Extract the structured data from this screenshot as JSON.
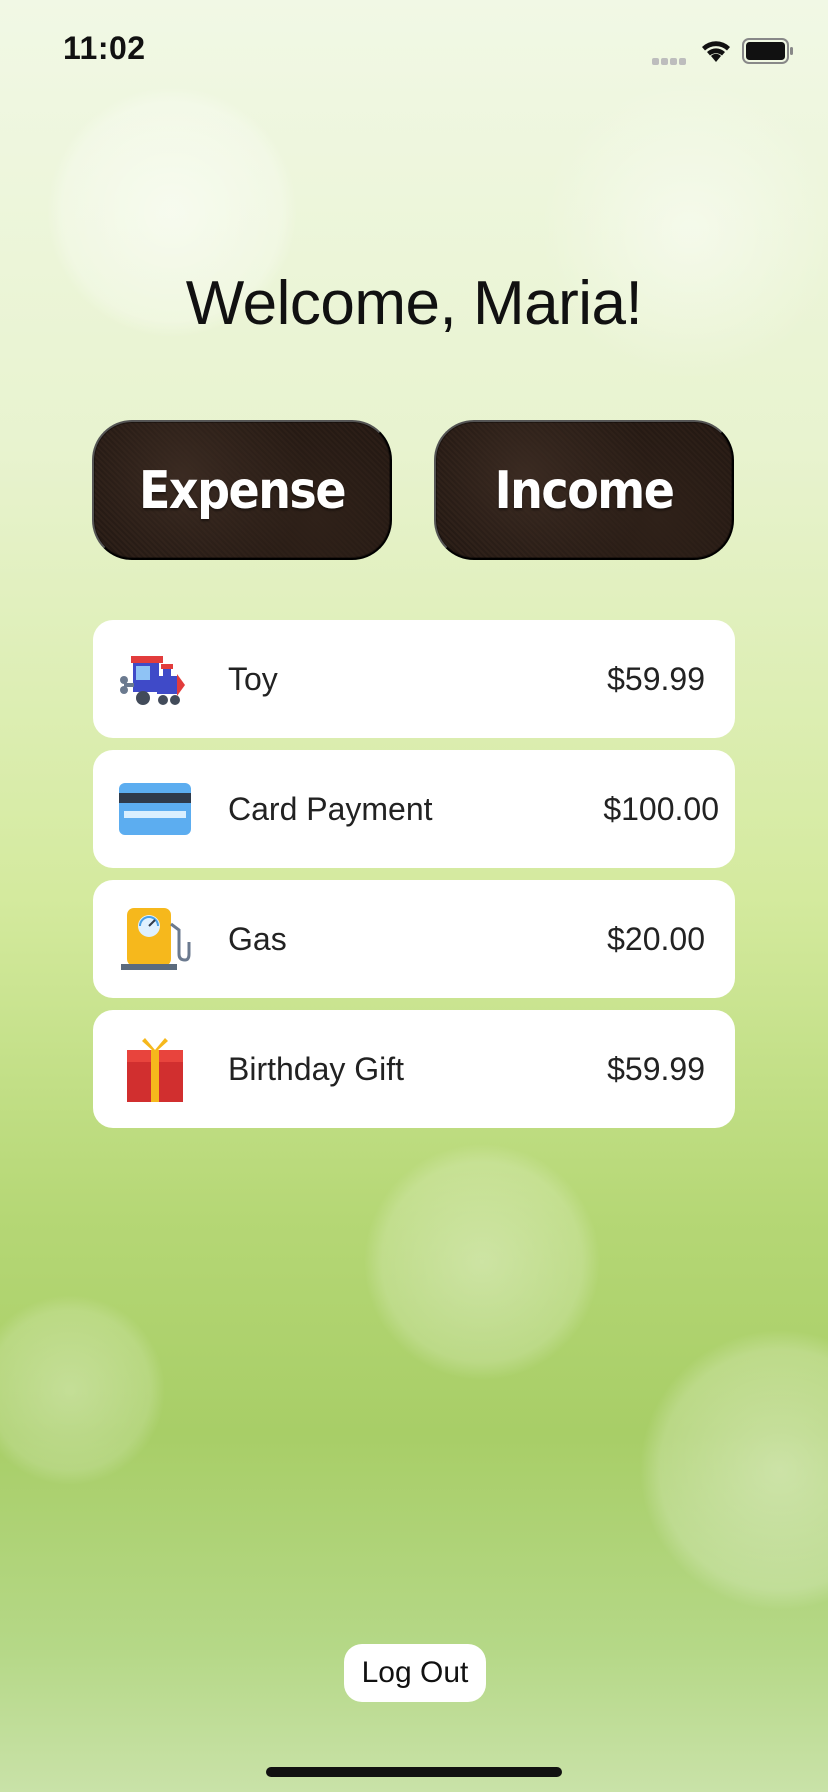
{
  "status_bar": {
    "time": "11:02",
    "icons": [
      "cellular-signal-icon",
      "wifi-icon",
      "battery-icon"
    ]
  },
  "welcome": {
    "title": "Welcome, Maria!"
  },
  "actions": {
    "expense_label": "Expense",
    "income_label": "Income"
  },
  "transactions": [
    {
      "icon": "toy-train-icon",
      "name": "Toy",
      "amount": "$59.99"
    },
    {
      "icon": "credit-card-icon",
      "name": "Card Payment",
      "amount": "$100.00"
    },
    {
      "icon": "gas-pump-icon",
      "name": "Gas",
      "amount": "$20.00"
    },
    {
      "icon": "gift-box-icon",
      "name": "Birthday Gift",
      "amount": "$59.99"
    }
  ],
  "footer": {
    "logout_label": "Log Out"
  },
  "colors": {
    "button_brown": "#24180f",
    "card_white": "#ffffff",
    "background_green": "#a8ce67"
  }
}
